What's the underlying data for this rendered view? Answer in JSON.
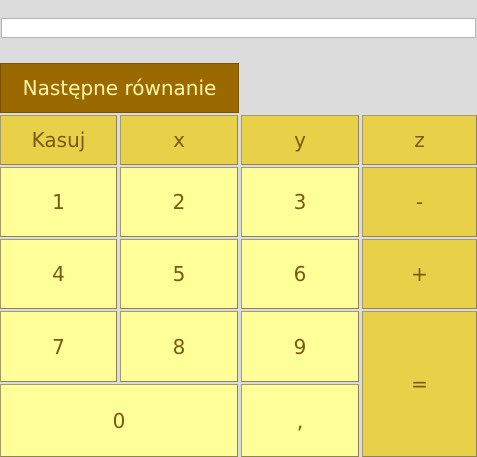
{
  "display": {
    "value": ""
  },
  "next_equation_label": "Następne równanie",
  "keys": {
    "clear": "Kasuj",
    "x": "x",
    "y": "y",
    "z": "z",
    "one": "1",
    "two": "2",
    "three": "3",
    "minus": "-",
    "four": "4",
    "five": "5",
    "six": "6",
    "plus": "+",
    "seven": "7",
    "eight": "8",
    "nine": "9",
    "equals": "=",
    "zero": "0",
    "comma": ","
  },
  "colors": {
    "background": "#dcdcdc",
    "next_button": "#9a6a00",
    "next_button_text": "#fff3a8",
    "key_light": "#ffff99",
    "key_dark": "#e8d048",
    "key_text": "#7a5a10"
  }
}
